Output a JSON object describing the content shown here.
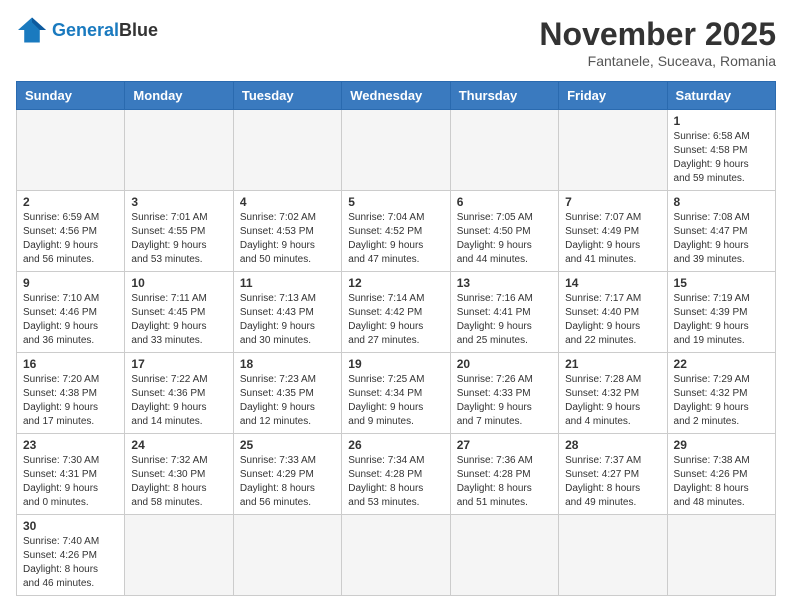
{
  "header": {
    "logo_general": "General",
    "logo_blue": "Blue",
    "month_year": "November 2025",
    "location": "Fantanele, Suceava, Romania"
  },
  "weekdays": [
    "Sunday",
    "Monday",
    "Tuesday",
    "Wednesday",
    "Thursday",
    "Friday",
    "Saturday"
  ],
  "weeks": [
    [
      {
        "day": "",
        "empty": true
      },
      {
        "day": "",
        "empty": true
      },
      {
        "day": "",
        "empty": true
      },
      {
        "day": "",
        "empty": true
      },
      {
        "day": "",
        "empty": true
      },
      {
        "day": "",
        "empty": true
      },
      {
        "day": "1",
        "sunrise": "6:58 AM",
        "sunset": "4:58 PM",
        "daylight_hours": "9 hours",
        "daylight_minutes": "and 59 minutes."
      }
    ],
    [
      {
        "day": "2",
        "sunrise": "6:59 AM",
        "sunset": "4:56 PM",
        "daylight_hours": "9 hours",
        "daylight_minutes": "and 56 minutes."
      },
      {
        "day": "3",
        "sunrise": "7:01 AM",
        "sunset": "4:55 PM",
        "daylight_hours": "9 hours",
        "daylight_minutes": "and 53 minutes."
      },
      {
        "day": "4",
        "sunrise": "7:02 AM",
        "sunset": "4:53 PM",
        "daylight_hours": "9 hours",
        "daylight_minutes": "and 50 minutes."
      },
      {
        "day": "5",
        "sunrise": "7:04 AM",
        "sunset": "4:52 PM",
        "daylight_hours": "9 hours",
        "daylight_minutes": "and 47 minutes."
      },
      {
        "day": "6",
        "sunrise": "7:05 AM",
        "sunset": "4:50 PM",
        "daylight_hours": "9 hours",
        "daylight_minutes": "and 44 minutes."
      },
      {
        "day": "7",
        "sunrise": "7:07 AM",
        "sunset": "4:49 PM",
        "daylight_hours": "9 hours",
        "daylight_minutes": "and 41 minutes."
      },
      {
        "day": "8",
        "sunrise": "7:08 AM",
        "sunset": "4:47 PM",
        "daylight_hours": "9 hours",
        "daylight_minutes": "and 39 minutes."
      }
    ],
    [
      {
        "day": "9",
        "sunrise": "7:10 AM",
        "sunset": "4:46 PM",
        "daylight_hours": "9 hours",
        "daylight_minutes": "and 36 minutes."
      },
      {
        "day": "10",
        "sunrise": "7:11 AM",
        "sunset": "4:45 PM",
        "daylight_hours": "9 hours",
        "daylight_minutes": "and 33 minutes."
      },
      {
        "day": "11",
        "sunrise": "7:13 AM",
        "sunset": "4:43 PM",
        "daylight_hours": "9 hours",
        "daylight_minutes": "and 30 minutes."
      },
      {
        "day": "12",
        "sunrise": "7:14 AM",
        "sunset": "4:42 PM",
        "daylight_hours": "9 hours",
        "daylight_minutes": "and 27 minutes."
      },
      {
        "day": "13",
        "sunrise": "7:16 AM",
        "sunset": "4:41 PM",
        "daylight_hours": "9 hours",
        "daylight_minutes": "and 25 minutes."
      },
      {
        "day": "14",
        "sunrise": "7:17 AM",
        "sunset": "4:40 PM",
        "daylight_hours": "9 hours",
        "daylight_minutes": "and 22 minutes."
      },
      {
        "day": "15",
        "sunrise": "7:19 AM",
        "sunset": "4:39 PM",
        "daylight_hours": "9 hours",
        "daylight_minutes": "and 19 minutes."
      }
    ],
    [
      {
        "day": "16",
        "sunrise": "7:20 AM",
        "sunset": "4:38 PM",
        "daylight_hours": "9 hours",
        "daylight_minutes": "and 17 minutes."
      },
      {
        "day": "17",
        "sunrise": "7:22 AM",
        "sunset": "4:36 PM",
        "daylight_hours": "9 hours",
        "daylight_minutes": "and 14 minutes."
      },
      {
        "day": "18",
        "sunrise": "7:23 AM",
        "sunset": "4:35 PM",
        "daylight_hours": "9 hours",
        "daylight_minutes": "and 12 minutes."
      },
      {
        "day": "19",
        "sunrise": "7:25 AM",
        "sunset": "4:34 PM",
        "daylight_hours": "9 hours",
        "daylight_minutes": "and 9 minutes."
      },
      {
        "day": "20",
        "sunrise": "7:26 AM",
        "sunset": "4:33 PM",
        "daylight_hours": "9 hours",
        "daylight_minutes": "and 7 minutes."
      },
      {
        "day": "21",
        "sunrise": "7:28 AM",
        "sunset": "4:32 PM",
        "daylight_hours": "9 hours",
        "daylight_minutes": "and 4 minutes."
      },
      {
        "day": "22",
        "sunrise": "7:29 AM",
        "sunset": "4:32 PM",
        "daylight_hours": "9 hours",
        "daylight_minutes": "and 2 minutes."
      }
    ],
    [
      {
        "day": "23",
        "sunrise": "7:30 AM",
        "sunset": "4:31 PM",
        "daylight_hours": "9 hours",
        "daylight_minutes": "and 0 minutes."
      },
      {
        "day": "24",
        "sunrise": "7:32 AM",
        "sunset": "4:30 PM",
        "daylight_hours": "8 hours",
        "daylight_minutes": "and 58 minutes."
      },
      {
        "day": "25",
        "sunrise": "7:33 AM",
        "sunset": "4:29 PM",
        "daylight_hours": "8 hours",
        "daylight_minutes": "and 56 minutes."
      },
      {
        "day": "26",
        "sunrise": "7:34 AM",
        "sunset": "4:28 PM",
        "daylight_hours": "8 hours",
        "daylight_minutes": "and 53 minutes."
      },
      {
        "day": "27",
        "sunrise": "7:36 AM",
        "sunset": "4:28 PM",
        "daylight_hours": "8 hours",
        "daylight_minutes": "and 51 minutes."
      },
      {
        "day": "28",
        "sunrise": "7:37 AM",
        "sunset": "4:27 PM",
        "daylight_hours": "8 hours",
        "daylight_minutes": "and 49 minutes."
      },
      {
        "day": "29",
        "sunrise": "7:38 AM",
        "sunset": "4:26 PM",
        "daylight_hours": "8 hours",
        "daylight_minutes": "and 48 minutes."
      }
    ],
    [
      {
        "day": "30",
        "sunrise": "7:40 AM",
        "sunset": "4:26 PM",
        "daylight_hours": "8 hours",
        "daylight_minutes": "and 46 minutes."
      },
      {
        "day": "",
        "empty": true
      },
      {
        "day": "",
        "empty": true
      },
      {
        "day": "",
        "empty": true
      },
      {
        "day": "",
        "empty": true
      },
      {
        "day": "",
        "empty": true
      },
      {
        "day": "",
        "empty": true
      }
    ]
  ]
}
